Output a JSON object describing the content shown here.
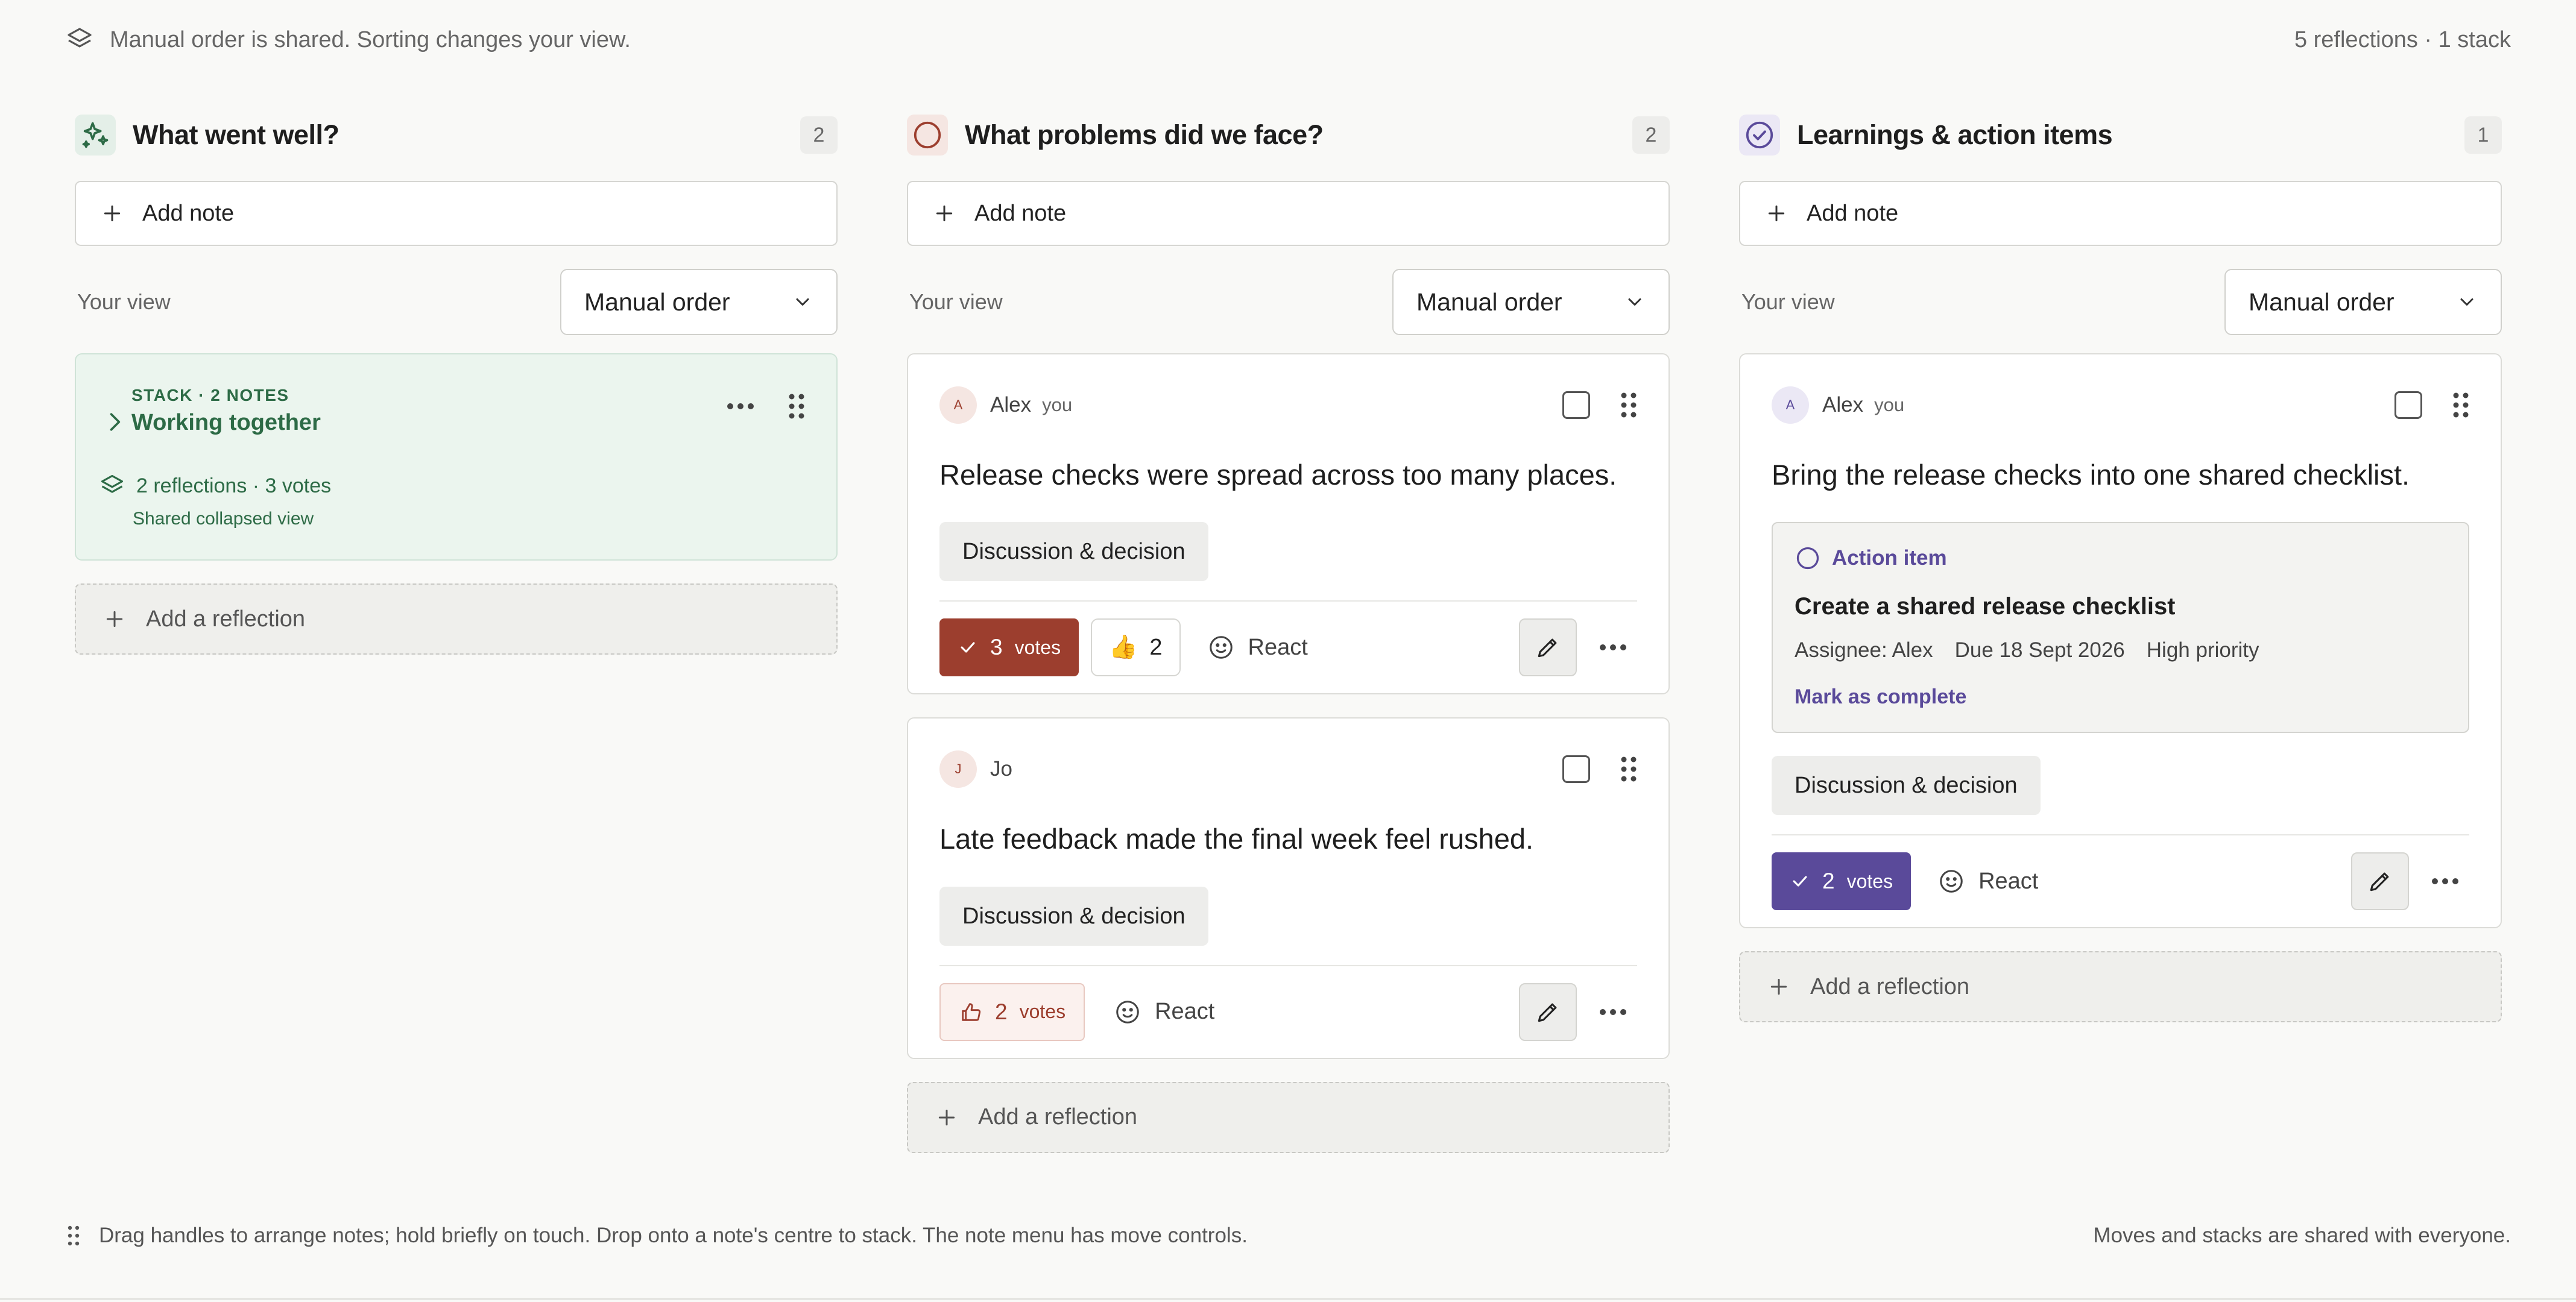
{
  "topbar": {
    "notice": "Manual order is shared. Sorting changes your view.",
    "summary": "5 reflections · 1 stack"
  },
  "colors": {
    "accent_green": "#2d6b46",
    "accent_red": "#9c3e2e",
    "accent_purple": "#5a4a9a"
  },
  "columns": [
    {
      "title": "What went well?",
      "icon": "sparkle-icon",
      "count": "2",
      "add_note": "Add note",
      "view_label": "Your view",
      "sort": "Manual order",
      "stack": {
        "label": "STACK · 2 NOTES",
        "title": "Working together",
        "meta": "2 reflections · 3 votes",
        "sub": "Shared collapsed view"
      },
      "add_reflection": "Add a reflection"
    },
    {
      "title": "What problems did we face?",
      "icon": "circle-icon",
      "count": "2",
      "add_note": "Add note",
      "view_label": "Your view",
      "sort": "Manual order",
      "cards": [
        {
          "avatar": "A",
          "author": "Alex",
          "you": "you",
          "text": "Release checks were spread across too many places.",
          "tag": "Discussion & decision",
          "votes": "3",
          "votes_label": "votes",
          "reaction_emoji": "👍",
          "reaction_count": "2",
          "react": "React"
        },
        {
          "avatar": "J",
          "author": "Jo",
          "text": "Late feedback made the final week feel rushed.",
          "tag": "Discussion & decision",
          "votes": "2",
          "votes_label": "votes",
          "react": "React"
        }
      ],
      "add_reflection": "Add a reflection"
    },
    {
      "title": "Learnings & action items",
      "icon": "check-circle-icon",
      "count": "1",
      "add_note": "Add note",
      "view_label": "Your view",
      "sort": "Manual order",
      "cards": [
        {
          "avatar": "A",
          "author": "Alex",
          "you": "you",
          "text": "Bring the release checks into one shared checklist.",
          "action": {
            "label": "Action item",
            "title": "Create a shared release checklist",
            "assignee": "Assignee: Alex",
            "due": "Due 18 Sept 2026",
            "priority": "High priority",
            "complete": "Mark as complete"
          },
          "tag": "Discussion & decision",
          "votes": "2",
          "votes_label": "votes",
          "react": "React"
        }
      ],
      "add_reflection": "Add a reflection"
    }
  ],
  "bottombar": {
    "hint": "Drag handles to arrange notes; hold briefly on touch. Drop onto a note's centre to stack. The note menu has move controls.",
    "shared": "Moves and stacks are shared with everyone."
  }
}
